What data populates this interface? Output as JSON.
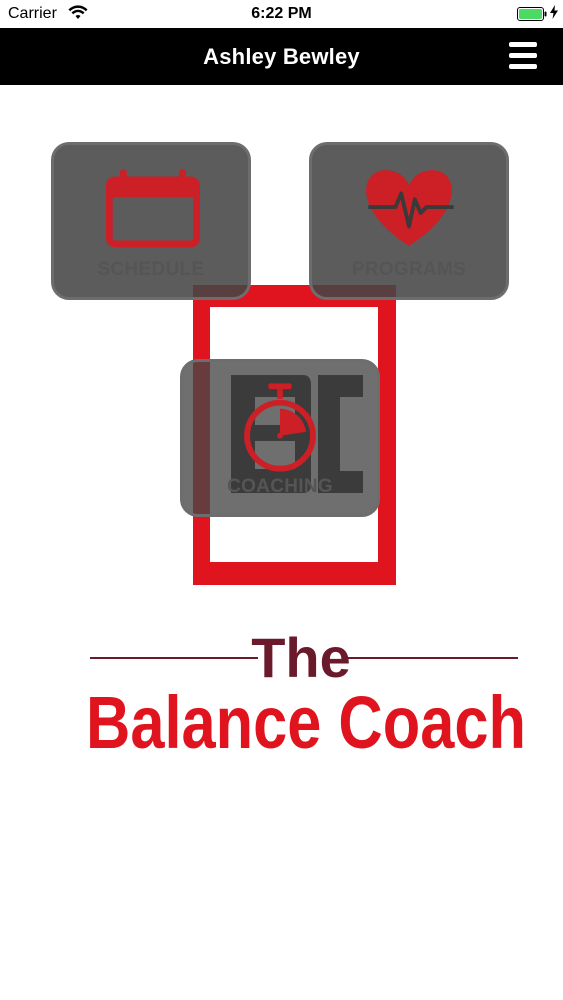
{
  "status": {
    "carrier": "Carrier",
    "time": "6:22 PM"
  },
  "nav": {
    "title": "Ashley Bewley",
    "menu_icon": "hamburger-menu-icon"
  },
  "tiles": [
    {
      "label": "SCHEDULE",
      "icon": "calendar-icon"
    },
    {
      "label": "PROGRAMS",
      "icon": "heart-pulse-icon"
    },
    {
      "label": "COACHING",
      "icon": "stopwatch-icon"
    }
  ],
  "logo": {
    "line1": "The",
    "line2": "Balance Coach"
  },
  "colors": {
    "accent": "#e0141e",
    "maroon": "#6b1a2c",
    "nav_bg": "#000000",
    "battery": "#4cd964"
  }
}
